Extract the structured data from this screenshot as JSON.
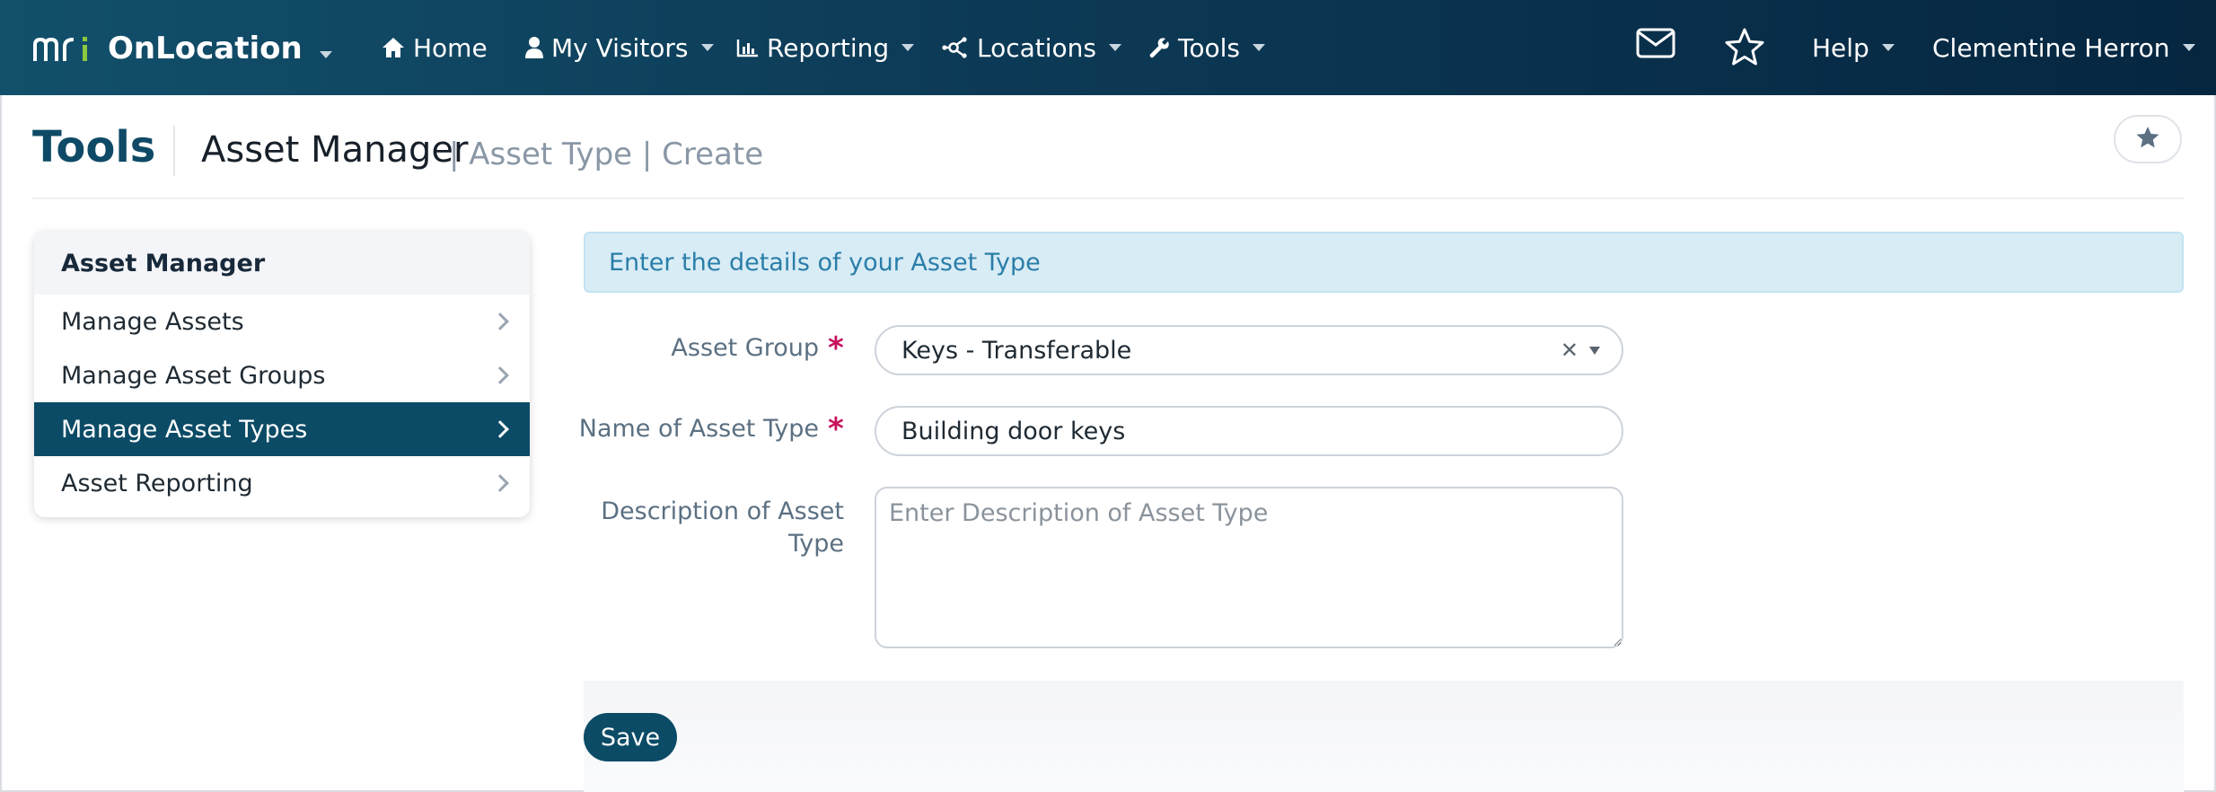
{
  "navbar": {
    "brand": "OnLocation",
    "items": [
      {
        "label": "Home",
        "icon": "home-icon"
      },
      {
        "label": "My Visitors",
        "icon": "user-icon"
      },
      {
        "label": "Reporting",
        "icon": "bar-chart-icon"
      },
      {
        "label": "Locations",
        "icon": "network-icon"
      },
      {
        "label": "Tools",
        "icon": "wrench-icon"
      }
    ],
    "help": "Help",
    "user": "Clementine Herron",
    "colors": {
      "bar_start": "#12506b",
      "bar_end": "#062640",
      "brand_green": "#8dc63f"
    }
  },
  "header": {
    "title": "Tools",
    "section": "Asset Manager",
    "crumbs": "| Asset Type | Create"
  },
  "sidebar": {
    "heading": "Asset Manager",
    "items": [
      {
        "label": "Manage Assets",
        "active": false
      },
      {
        "label": "Manage Asset Groups",
        "active": false
      },
      {
        "label": "Manage Asset Types",
        "active": true
      },
      {
        "label": "Asset Reporting",
        "active": false
      }
    ],
    "active_color": "#0b4b66"
  },
  "form": {
    "notice": "Enter the details of your Asset Type",
    "asset_group": {
      "label": "Asset Group",
      "value": "Keys - Transferable",
      "required": "*"
    },
    "name": {
      "label": "Name of Asset Type",
      "value": "Building door keys",
      "required": "*"
    },
    "description": {
      "label_line1": "Description of Asset",
      "label_line2": "Type",
      "placeholder": "Enter Description of Asset Type",
      "value": ""
    },
    "save_label": "Save"
  }
}
